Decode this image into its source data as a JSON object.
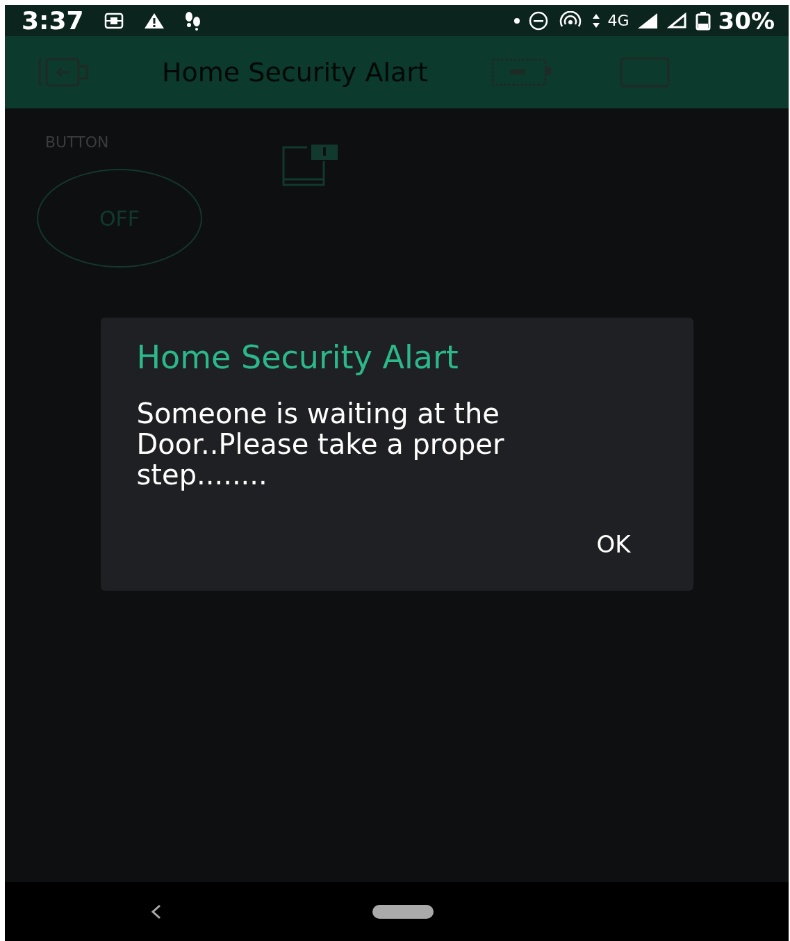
{
  "status_bar": {
    "time": "3:37",
    "network": "4G",
    "battery": "30%"
  },
  "app_bar": {
    "title": "Home Security Alart"
  },
  "widget": {
    "label": "BUTTON",
    "button_text": "OFF"
  },
  "dialog": {
    "title": "Home Security Alart",
    "message": "Someone is waiting at the Door..Please take a proper step........",
    "buttons": [
      "OK"
    ]
  }
}
